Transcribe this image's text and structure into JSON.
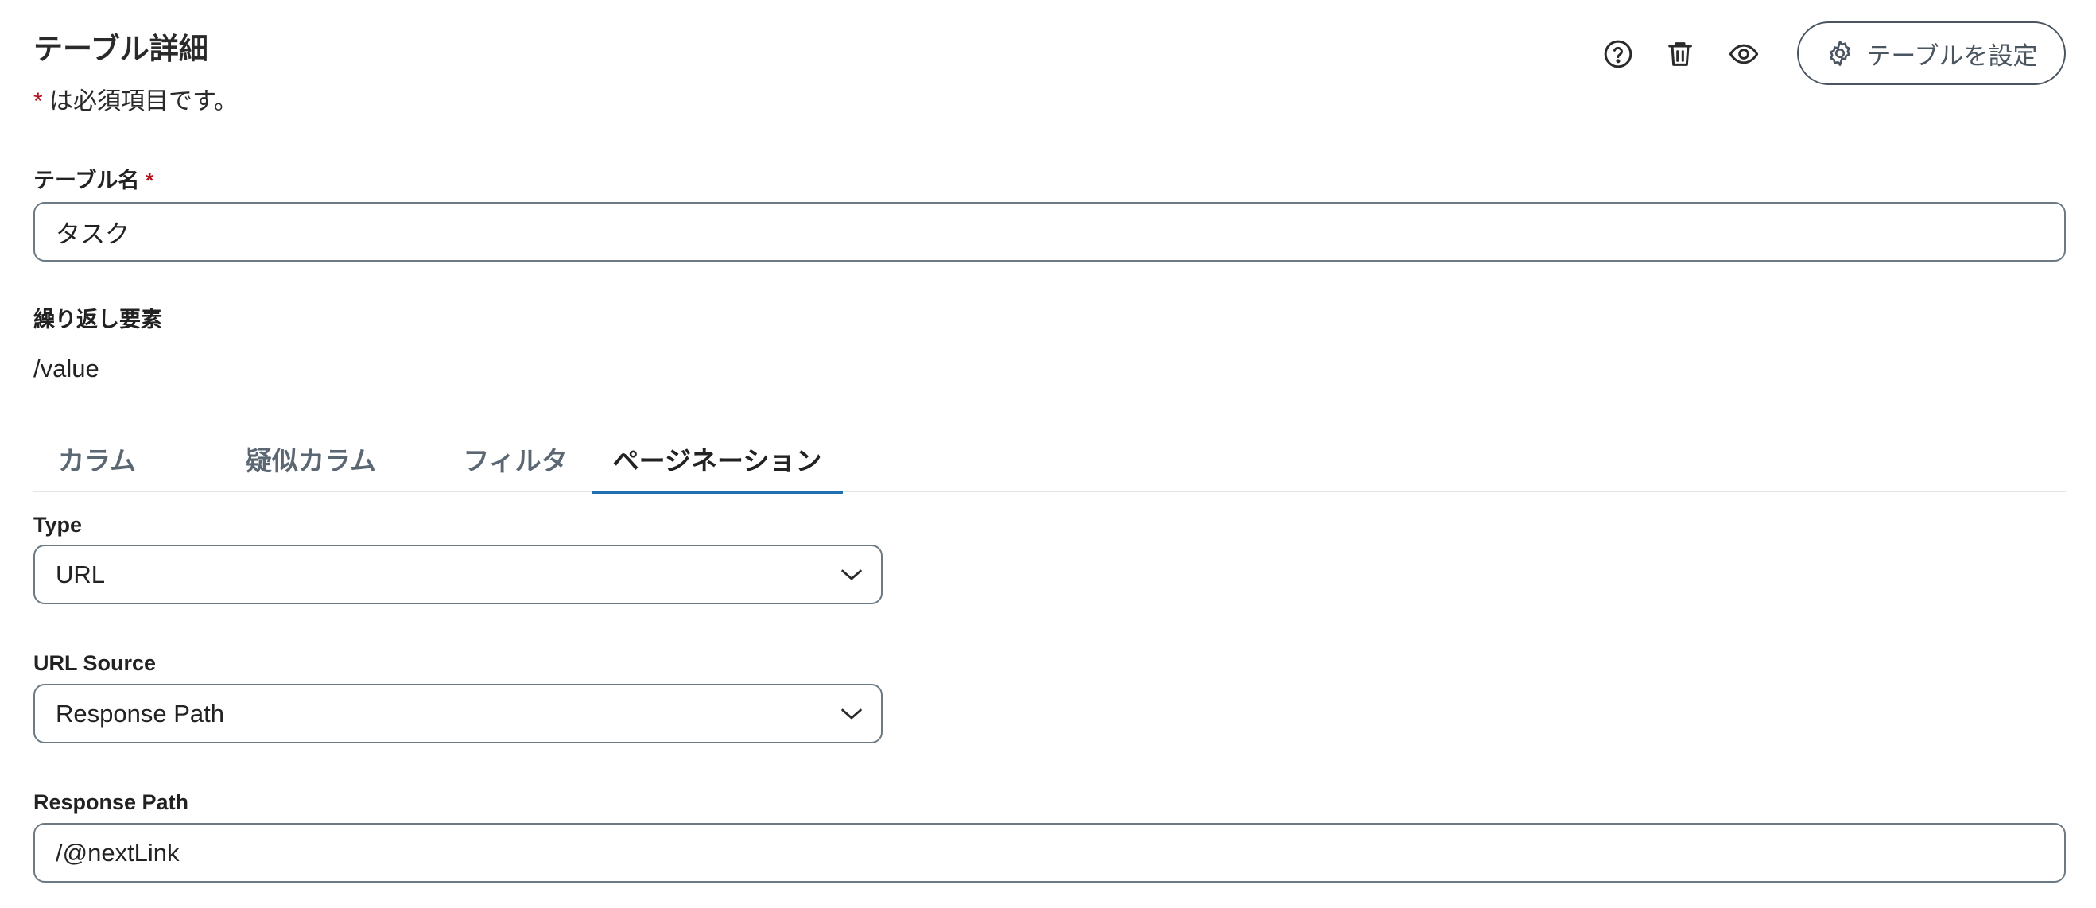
{
  "header": {
    "title": "テーブル詳細",
    "required_asterisk": "*",
    "required_note": " は必須項目です。",
    "configure_button_label": "テーブルを設定"
  },
  "toolbar": {
    "icons": [
      "help-icon",
      "trash-icon",
      "eye-icon"
    ]
  },
  "table_name": {
    "label": "テーブル名",
    "required_asterisk": "*",
    "value": "タスク"
  },
  "repeat_element": {
    "label": "繰り返し要素",
    "value": "/value"
  },
  "tabs": [
    {
      "label": "カラム",
      "active": false
    },
    {
      "label": "疑似カラム",
      "active": false
    },
    {
      "label": "フィルタ",
      "active": false
    },
    {
      "label": "ページネーション",
      "active": true
    }
  ],
  "pagination": {
    "type": {
      "label": "Type",
      "selected": "URL"
    },
    "url_source": {
      "label": "URL Source",
      "selected": "Response Path"
    },
    "response_path": {
      "label": "Response Path",
      "value": "/@nextLink"
    }
  },
  "colors": {
    "accent": "#1f6fb2",
    "required": "#b3121f",
    "border": "#6b7a85"
  }
}
